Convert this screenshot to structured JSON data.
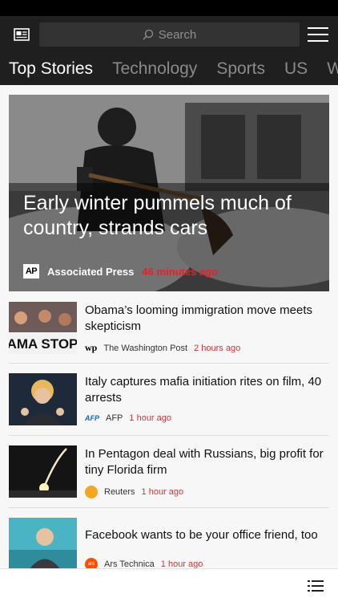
{
  "search": {
    "placeholder": "Search"
  },
  "tabs": [
    {
      "label": "Top Stories"
    },
    {
      "label": "Technology"
    },
    {
      "label": "Sports"
    },
    {
      "label": "US"
    },
    {
      "label": "World"
    }
  ],
  "hero": {
    "title": "Early winter pummels much of country, strands cars",
    "source_logo": "AP",
    "source": "Associated Press",
    "time": "46 minutes ago"
  },
  "articles": [
    {
      "title": "Obama’s looming immigration move meets skepticism",
      "source_logo": "wp",
      "source": "The Washington Post",
      "time": "2 hours ago",
      "thumb_text": "AMA STOP"
    },
    {
      "title": "Italy captures mafia initiation rites on film, 40 arrests",
      "source_logo": "AFP",
      "source": "AFP",
      "time": "1 hour ago"
    },
    {
      "title": "In Pentagon deal with Russians, big profit for tiny Florida firm",
      "source_logo": "reuters-logo",
      "source": "Reuters",
      "time": "1 hour ago"
    },
    {
      "title": "Facebook wants to be your office friend, too",
      "source_logo": "ars",
      "source": "Ars Technica",
      "time": "1 hour ago"
    }
  ],
  "colors": {
    "header_bg": "#1f1f1f",
    "accent_time": "#d13438",
    "hero_time": "#e0232b"
  }
}
